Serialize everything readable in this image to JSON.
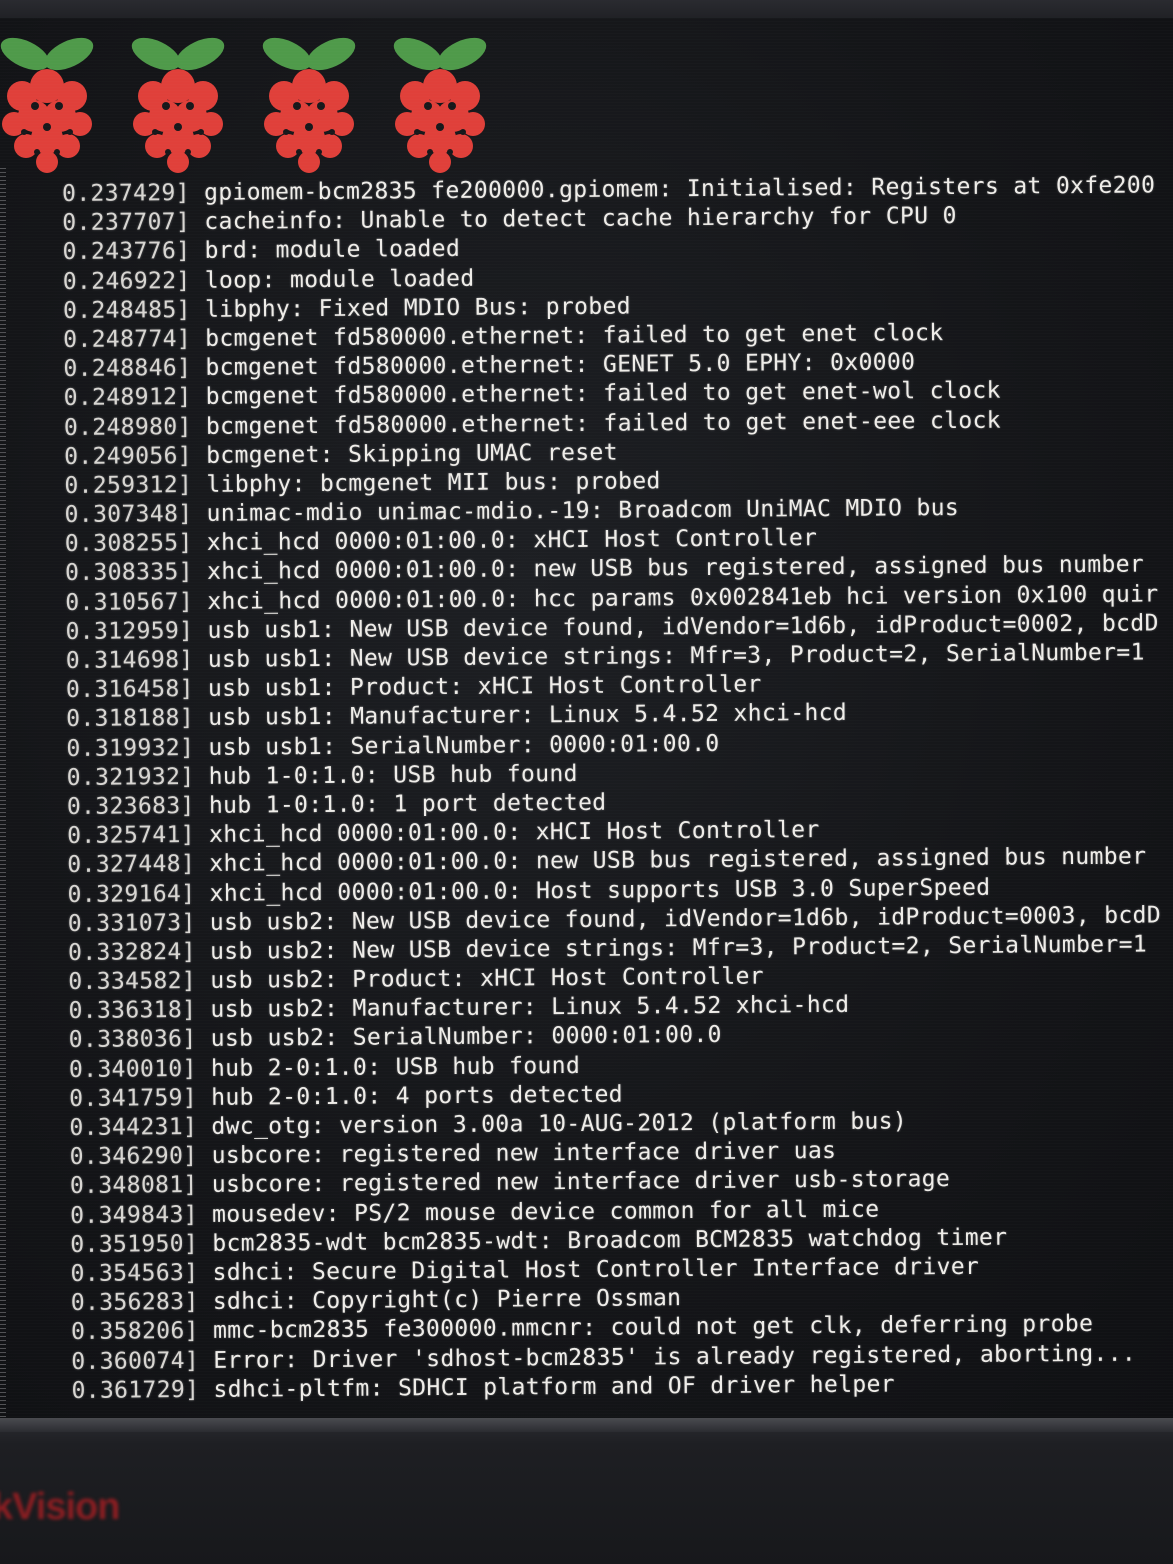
{
  "boot_logo": {
    "count": 4,
    "icon": "raspberry-pi-logo",
    "colors": {
      "berry": "#e0403a",
      "leaf": "#4f9a4a"
    }
  },
  "bezel_brand": "kVision",
  "log": [
    {
      "ts": "0.237429]",
      "msg": "gpiomem-bcm2835 fe200000.gpiomem: Initialised: Registers at 0xfe200"
    },
    {
      "ts": "0.237707]",
      "msg": "cacheinfo: Unable to detect cache hierarchy for CPU 0"
    },
    {
      "ts": "0.243776]",
      "msg": "brd: module loaded"
    },
    {
      "ts": "0.246922]",
      "msg": "loop: module loaded"
    },
    {
      "ts": "0.248485]",
      "msg": "libphy: Fixed MDIO Bus: probed"
    },
    {
      "ts": "0.248774]",
      "msg": "bcmgenet fd580000.ethernet: failed to get enet clock"
    },
    {
      "ts": "0.248846]",
      "msg": "bcmgenet fd580000.ethernet: GENET 5.0 EPHY: 0x0000"
    },
    {
      "ts": "0.248912]",
      "msg": "bcmgenet fd580000.ethernet: failed to get enet-wol clock"
    },
    {
      "ts": "0.248980]",
      "msg": "bcmgenet fd580000.ethernet: failed to get enet-eee clock"
    },
    {
      "ts": "0.249056]",
      "msg": "bcmgenet: Skipping UMAC reset"
    },
    {
      "ts": "0.259312]",
      "msg": "libphy: bcmgenet MII bus: probed"
    },
    {
      "ts": "0.307348]",
      "msg": "unimac-mdio unimac-mdio.-19: Broadcom UniMAC MDIO bus"
    },
    {
      "ts": "0.308255]",
      "msg": "xhci_hcd 0000:01:00.0: xHCI Host Controller"
    },
    {
      "ts": "0.308335]",
      "msg": "xhci_hcd 0000:01:00.0: new USB bus registered, assigned bus number"
    },
    {
      "ts": "0.310567]",
      "msg": "xhci_hcd 0000:01:00.0: hcc params 0x002841eb hci version 0x100 quir"
    },
    {
      "ts": "0.312959]",
      "msg": "usb usb1: New USB device found, idVendor=1d6b, idProduct=0002, bcdD"
    },
    {
      "ts": "0.314698]",
      "msg": "usb usb1: New USB device strings: Mfr=3, Product=2, SerialNumber=1"
    },
    {
      "ts": "0.316458]",
      "msg": "usb usb1: Product: xHCI Host Controller"
    },
    {
      "ts": "0.318188]",
      "msg": "usb usb1: Manufacturer: Linux 5.4.52 xhci-hcd"
    },
    {
      "ts": "0.319932]",
      "msg": "usb usb1: SerialNumber: 0000:01:00.0"
    },
    {
      "ts": "0.321932]",
      "msg": "hub 1-0:1.0: USB hub found"
    },
    {
      "ts": "0.323683]",
      "msg": "hub 1-0:1.0: 1 port detected"
    },
    {
      "ts": "0.325741]",
      "msg": "xhci_hcd 0000:01:00.0: xHCI Host Controller"
    },
    {
      "ts": "0.327448]",
      "msg": "xhci_hcd 0000:01:00.0: new USB bus registered, assigned bus number"
    },
    {
      "ts": "0.329164]",
      "msg": "xhci_hcd 0000:01:00.0: Host supports USB 3.0 SuperSpeed"
    },
    {
      "ts": "0.331073]",
      "msg": "usb usb2: New USB device found, idVendor=1d6b, idProduct=0003, bcdD"
    },
    {
      "ts": "0.332824]",
      "msg": "usb usb2: New USB device strings: Mfr=3, Product=2, SerialNumber=1"
    },
    {
      "ts": "0.334582]",
      "msg": "usb usb2: Product: xHCI Host Controller"
    },
    {
      "ts": "0.336318]",
      "msg": "usb usb2: Manufacturer: Linux 5.4.52 xhci-hcd"
    },
    {
      "ts": "0.338036]",
      "msg": "usb usb2: SerialNumber: 0000:01:00.0"
    },
    {
      "ts": "0.340010]",
      "msg": "hub 2-0:1.0: USB hub found"
    },
    {
      "ts": "0.341759]",
      "msg": "hub 2-0:1.0: 4 ports detected"
    },
    {
      "ts": "0.344231]",
      "msg": "dwc_otg: version 3.00a 10-AUG-2012 (platform bus)"
    },
    {
      "ts": "0.346290]",
      "msg": "usbcore: registered new interface driver uas"
    },
    {
      "ts": "0.348081]",
      "msg": "usbcore: registered new interface driver usb-storage"
    },
    {
      "ts": "0.349843]",
      "msg": "mousedev: PS/2 mouse device common for all mice"
    },
    {
      "ts": "0.351950]",
      "msg": "bcm2835-wdt bcm2835-wdt: Broadcom BCM2835 watchdog timer"
    },
    {
      "ts": "0.354563]",
      "msg": "sdhci: Secure Digital Host Controller Interface driver"
    },
    {
      "ts": "0.356283]",
      "msg": "sdhci: Copyright(c) Pierre Ossman"
    },
    {
      "ts": "0.358206]",
      "msg": "mmc-bcm2835 fe300000.mmcnr: could not get clk, deferring probe"
    },
    {
      "ts": "0.360074]",
      "msg": "Error: Driver 'sdhost-bcm2835' is already registered, aborting..."
    },
    {
      "ts": "0.361729]",
      "msg": "sdhci-pltfm: SDHCI platform and OF driver helper"
    }
  ]
}
